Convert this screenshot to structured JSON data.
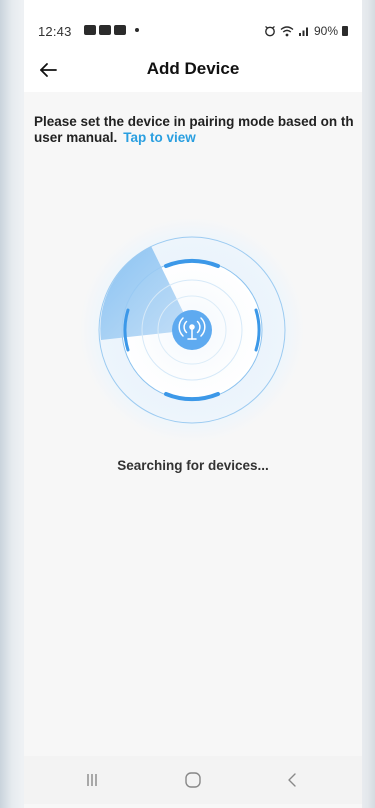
{
  "status_bar": {
    "time": "12:43",
    "battery_text": "90%",
    "icons_left": [
      "gallery-icon",
      "youtube-icon",
      "app-icon",
      "dot-icon"
    ],
    "icons_right": [
      "alarm-icon",
      "wifi-icon",
      "signal-icon",
      "battery-icon"
    ]
  },
  "header": {
    "title": "Add Device"
  },
  "instructions": {
    "text": "Please set the device in pairing mode based on th",
    "text_line2": "user manual.",
    "link_label": "Tap to view"
  },
  "radar": {
    "center_icon": "antenna-icon"
  },
  "status_message": "Searching for devices...",
  "nav_bar": {
    "buttons": [
      "recent-apps",
      "home",
      "back"
    ]
  },
  "colors": {
    "accent": "#2a9fe0",
    "radar_blue": "#4aa3ea",
    "background": "#f7f7f7"
  }
}
